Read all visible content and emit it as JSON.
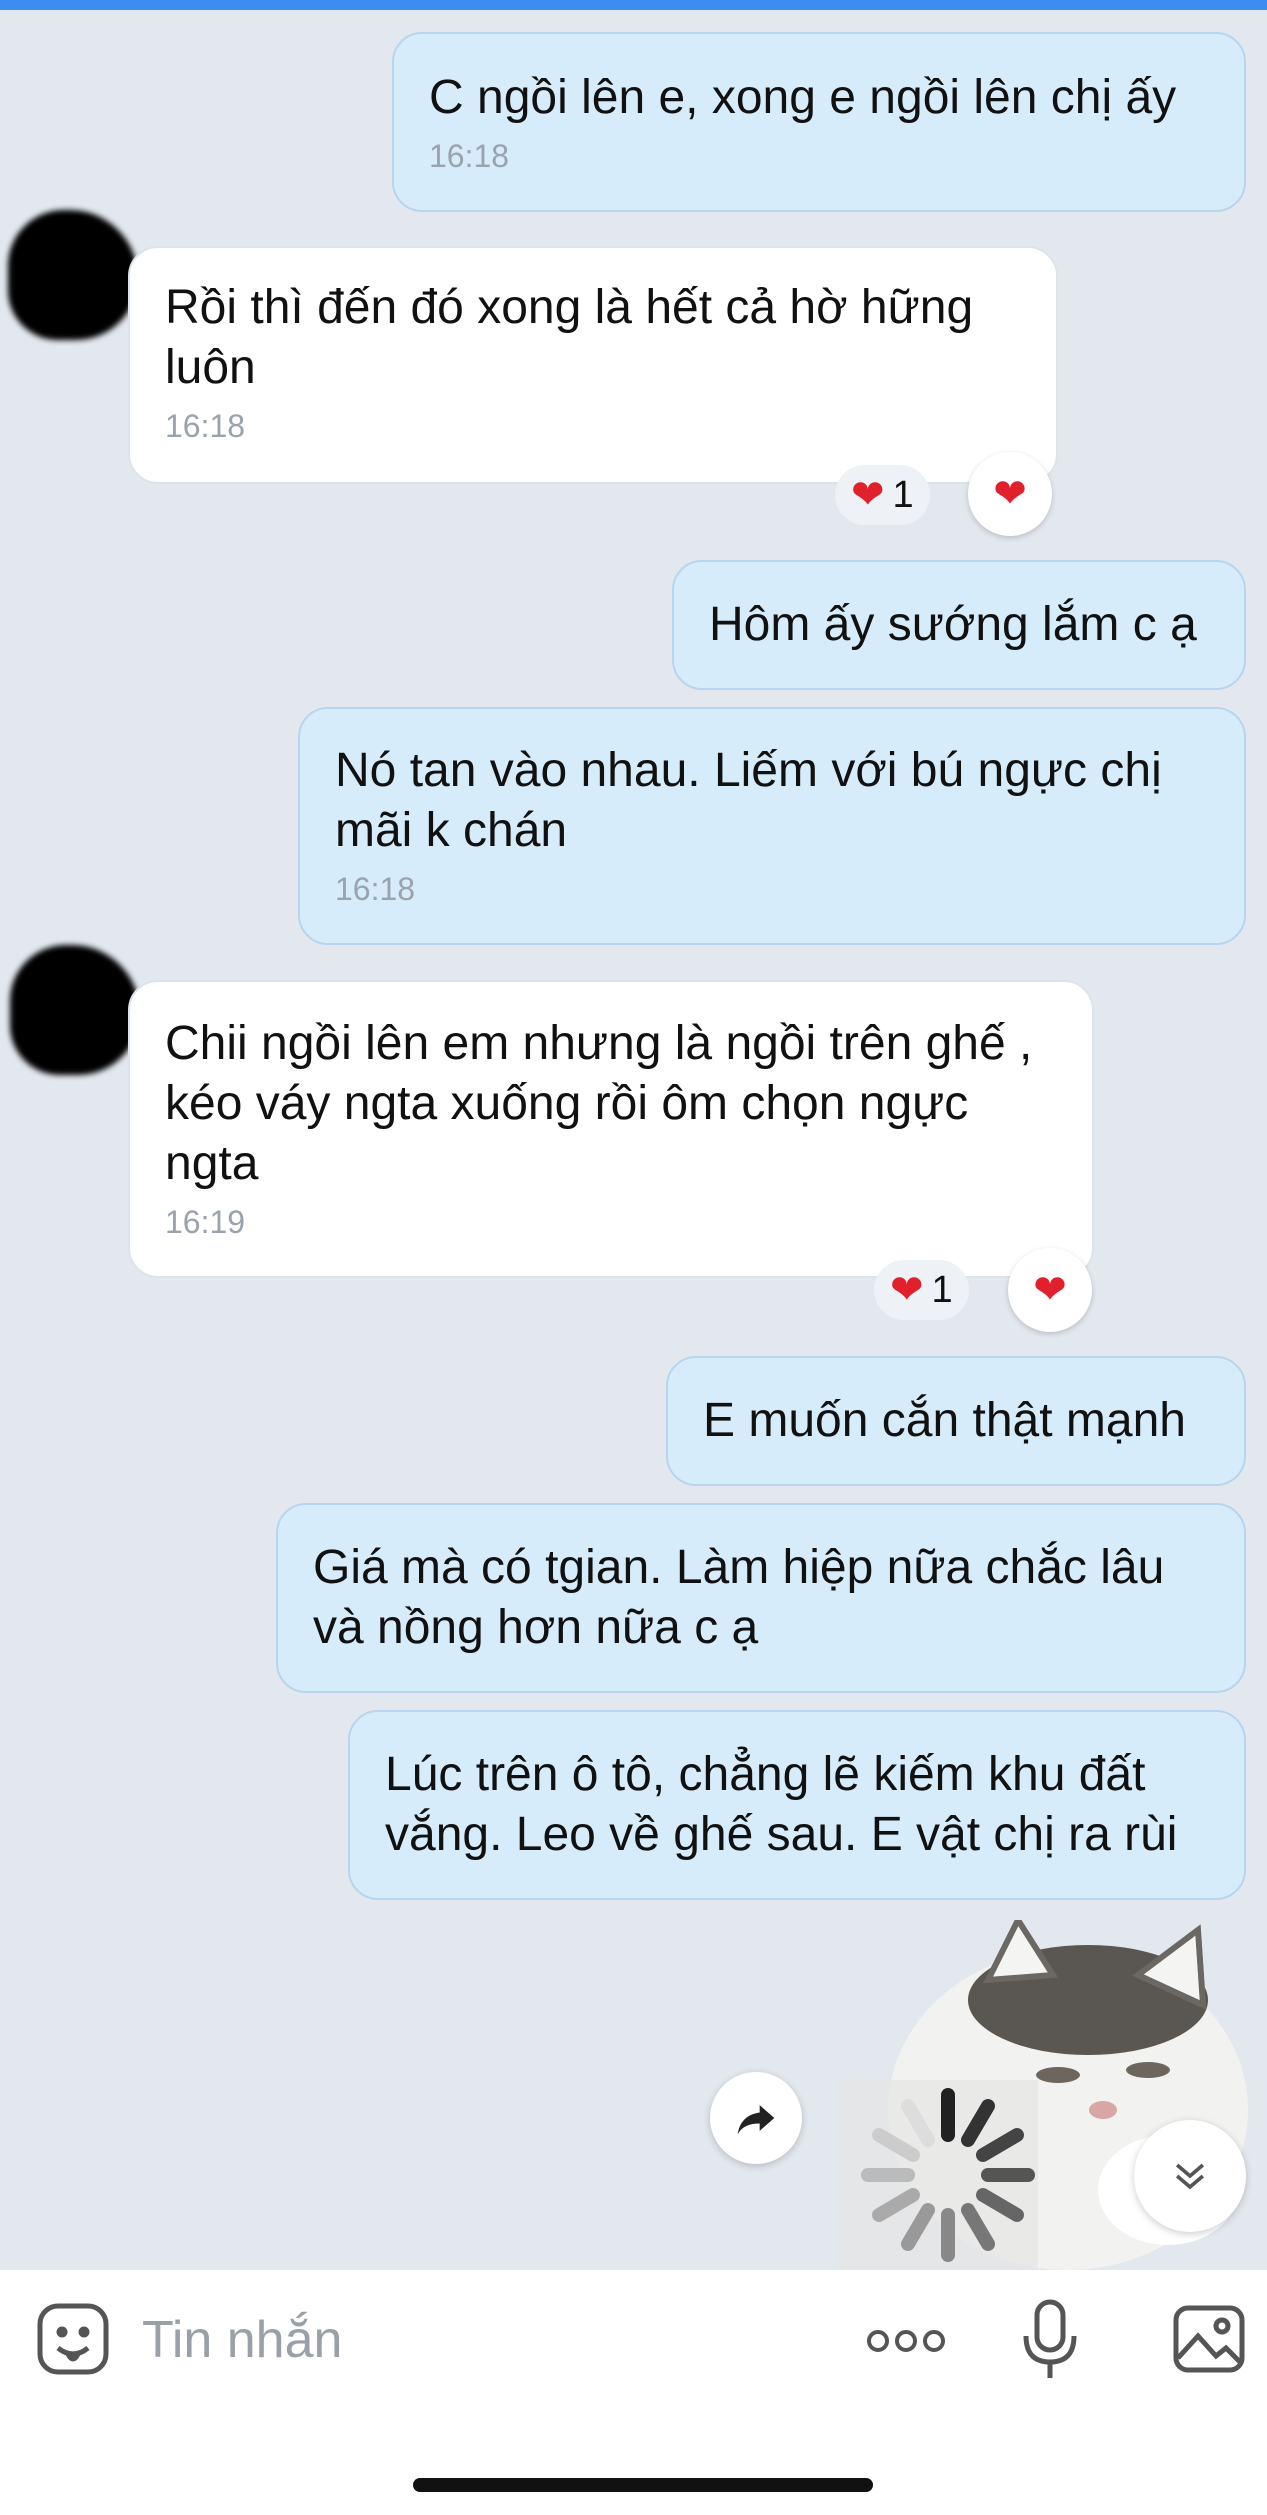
{
  "messages": [
    {
      "dir": "out",
      "text": "C ngồi lên e, xong e ngồi lên chị ấy",
      "time": "16:18"
    },
    {
      "dir": "in",
      "text": "Rồi thì đến đó xong là hết cả hờ hững luôn",
      "time": "16:18",
      "reaction_count": "1"
    },
    {
      "dir": "out",
      "text": "Hôm ấy sướng lắm c ạ"
    },
    {
      "dir": "out",
      "text": "Nó tan vào nhau. Liếm với bú ngực chị mãi k chán",
      "time": "16:18"
    },
    {
      "dir": "in",
      "text": "Chii ngồi lên em nhưng là ngồi trên ghế , kéo váy ngta xuống rồi ôm chọn ngực ngta",
      "time": "16:19",
      "reaction_count": "1"
    },
    {
      "dir": "out",
      "text": "E muốn cắn thật mạnh"
    },
    {
      "dir": "out",
      "text": "Giá mà có tgian. Làm hiệp nữa chắc lâu và nồng hơn nữa c ạ"
    },
    {
      "dir": "out",
      "text": "Lúc trên ô tô, chẳng lẽ kiếm khu đất vắng. Leo về ghế sau. E vật chị ra rùi"
    }
  ],
  "reaction_icon": "heart-icon",
  "composer": {
    "placeholder": "Tin nhắn"
  },
  "colors": {
    "outgoing": "#d7ecfb",
    "incoming": "#ffffff",
    "background": "#e3e8ef",
    "heart": "#e0202a"
  }
}
